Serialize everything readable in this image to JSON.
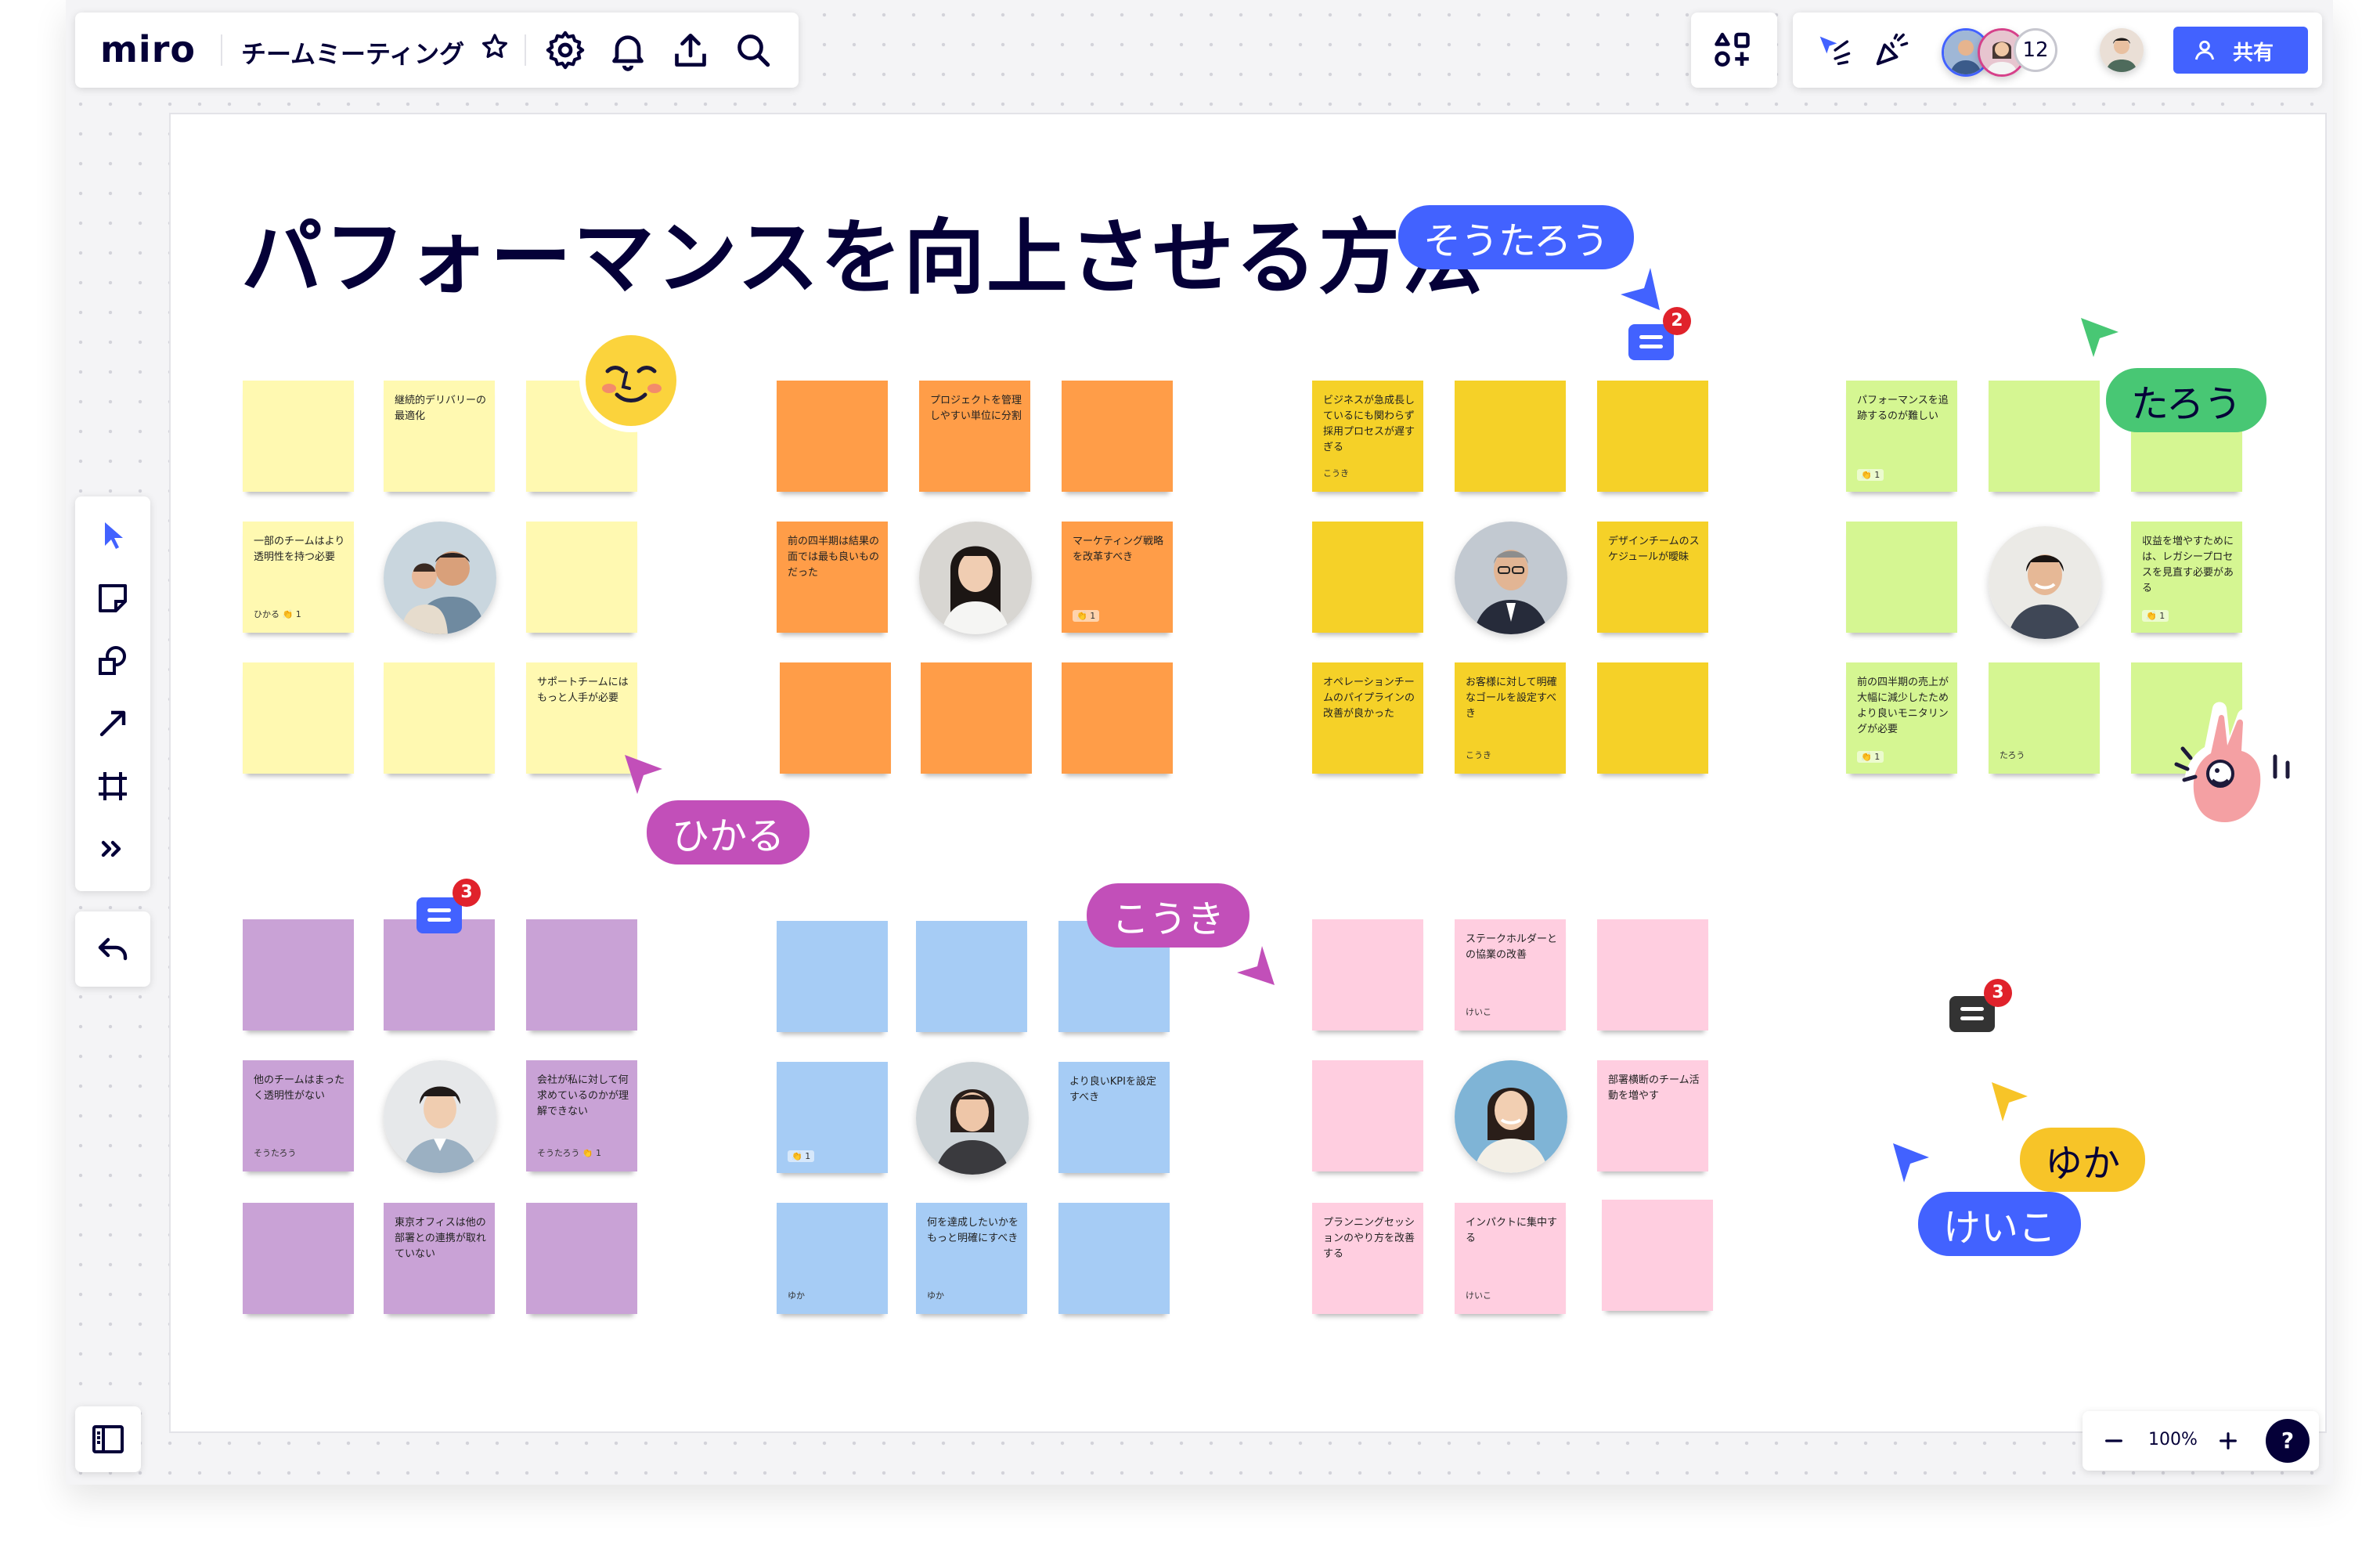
{
  "app": {
    "logo": "miro",
    "board_title": "チームミーティング",
    "share_label": "共有",
    "collaborator_count": "12",
    "zoom_level": "100%",
    "help_label": "?"
  },
  "toolbar_icons": [
    "star-icon",
    "settings-icon",
    "bell-icon",
    "upload-icon",
    "search-icon"
  ],
  "left_tools": [
    "select-cursor-tool",
    "sticky-note-tool",
    "shapes-tool",
    "arrow-line-tool",
    "frame-tool",
    "more-tools"
  ],
  "board": {
    "title": "パフォーマンスを向上させる方法",
    "colors": {
      "yellow": "#fff9b1",
      "orange": "#ff9d48",
      "gold": "#f5d128",
      "green": "#d5f692",
      "purple": "#c9a2d6",
      "blue": "#a6ccf5",
      "pink": "#ffcee0"
    }
  },
  "participants": {
    "soutarou": {
      "name": "そうたろう",
      "color": "#4262ff"
    },
    "tarou": {
      "name": "たろう",
      "color": "#48c774"
    },
    "hikaru": {
      "name": "ひかる",
      "color": "#c24fb9"
    },
    "kouki": {
      "name": "こうき",
      "color": "#c24fb9"
    },
    "yuka": {
      "name": "ゆか",
      "color": "#f7c428"
    },
    "keiko": {
      "name": "けいこ",
      "color": "#4262ff"
    }
  },
  "comments": [
    {
      "count": "2",
      "color": "#4262ff"
    },
    {
      "count": "3",
      "color": "#4262ff"
    },
    {
      "count": "3",
      "color": "#333333"
    }
  ],
  "notes": {
    "y2": {
      "text": "継続的デリバリーの最適化"
    },
    "y4": {
      "text": "一部のチームはより透明性を持つ必要",
      "author": "ひかる",
      "react": "👏 1"
    },
    "y9": {
      "text": "サポートチームにはもっと人手が必要"
    },
    "o2": {
      "text": "プロジェクトを管理しやすい単位に分割"
    },
    "o4": {
      "text": "前の四半期は結果の面では最も良いものだった"
    },
    "o6": {
      "text": "マーケティング戦略を改革すべき",
      "react": "👏 1"
    },
    "g1": {
      "text": "ビジネスが急成長しているにも関わらず採用プロセスが遅すぎる",
      "author": "こうき"
    },
    "g6": {
      "text": "デザインチームのスケジュールが曖昧"
    },
    "g7": {
      "text": "オペレーションチームのパイプラインの改善が良かった"
    },
    "g8": {
      "text": "お客様に対して明確なゴールを設定すべき",
      "author": "こうき"
    },
    "l1": {
      "text": "パフォーマンスを追跡するのが難しい",
      "react": "👏 1"
    },
    "l6": {
      "text": "収益を増やすためには、レガシープロセスを見直す必要がある",
      "react": "👏 1"
    },
    "l7": {
      "text": "前の四半期の売上が大幅に減少したためより良いモニタリングが必要",
      "react": "👏 1"
    },
    "l8": {
      "author": "たろう"
    },
    "p4": {
      "text": "他のチームはまったく透明性がない",
      "author": "そうたろう"
    },
    "p6": {
      "text": "会社が私に対して何求めているのかが理解できない",
      "author": "そうたろう",
      "react": "👏 1"
    },
    "p8": {
      "text": "東京オフィスは他の部署との連携が取れていない"
    },
    "b4": {
      "react": "👏 1"
    },
    "b6": {
      "text": "より良いKPIを設定すべき"
    },
    "b7": {
      "author": "ゆか"
    },
    "b8": {
      "text": "何を達成したいかをもっと明確にすべき",
      "author": "ゆか"
    },
    "k2": {
      "text": "ステークホルダーとの協業の改善",
      "author": "けいこ"
    },
    "k6": {
      "text": "部署横断のチーム活動を増やす"
    },
    "k7": {
      "text": "プランニングセッションのやり方を改善する"
    },
    "k8": {
      "text": "インパクトに集中する",
      "author": "けいこ"
    }
  }
}
